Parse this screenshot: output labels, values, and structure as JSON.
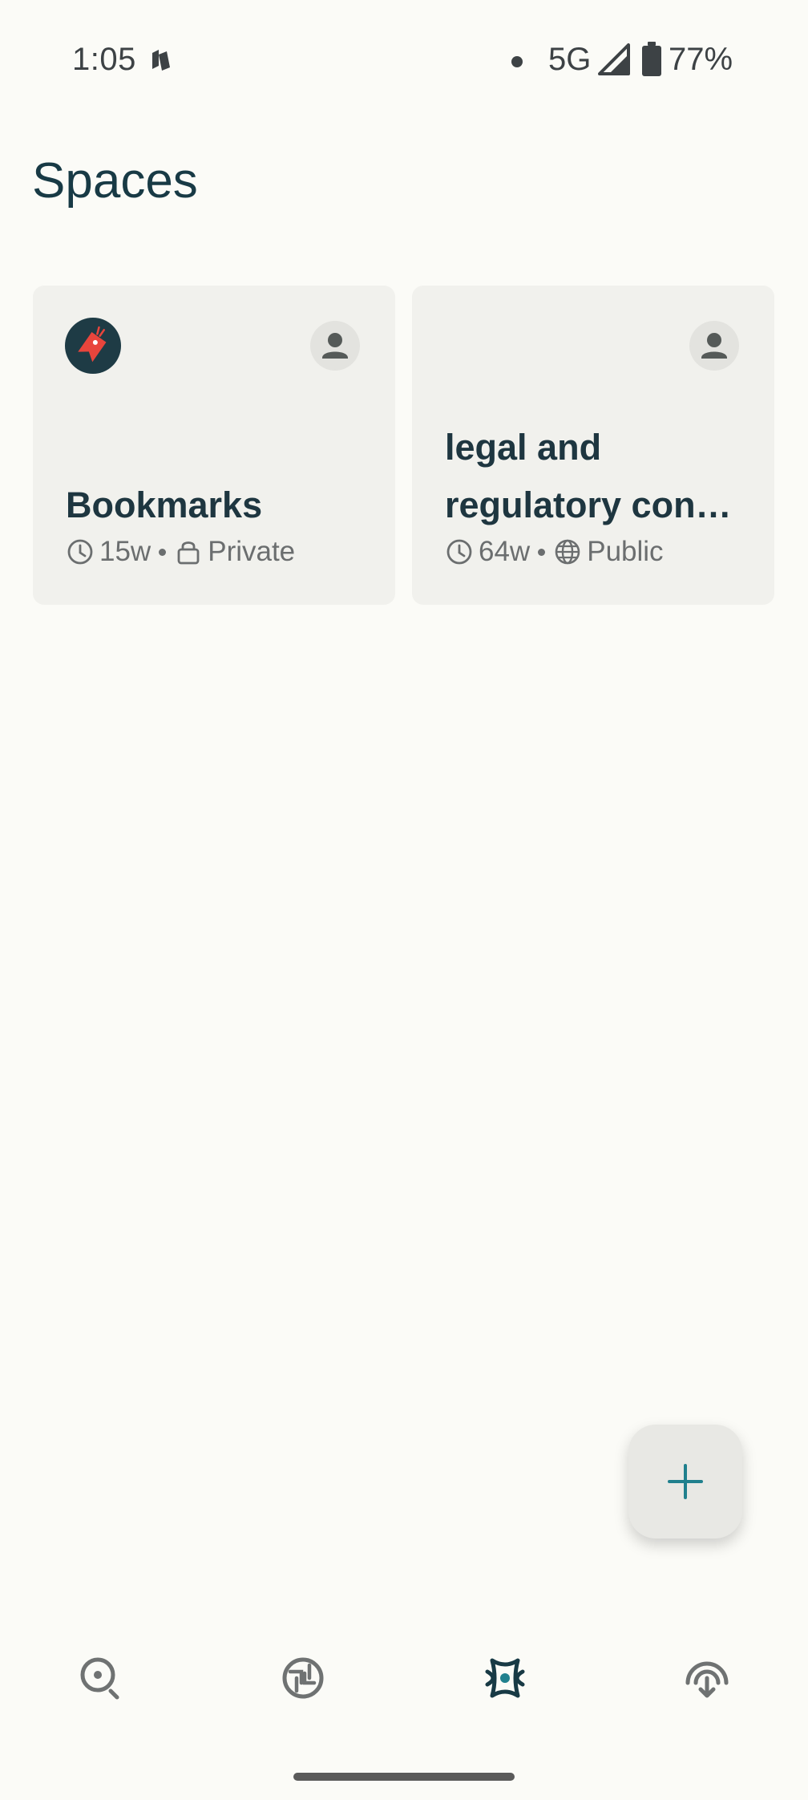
{
  "status_bar": {
    "time": "1:05",
    "network": "5G",
    "battery": "77%"
  },
  "page": {
    "title": "Spaces"
  },
  "spaces": [
    {
      "title": "Bookmarks",
      "age": "15w",
      "visibility": "Private",
      "visibility_icon": "lock-icon"
    },
    {
      "title": "legal and regulatory con…",
      "age": "64w",
      "visibility": "Public",
      "visibility_icon": "globe-icon"
    }
  ],
  "bottom_nav": {
    "items": [
      {
        "icon": "search-icon"
      },
      {
        "icon": "discover-icon"
      },
      {
        "icon": "spaces-icon",
        "active": true
      },
      {
        "icon": "library-icon"
      }
    ]
  },
  "colors": {
    "background": "#fbfbf7",
    "card": "#f1f1ed",
    "accent": "#20808d",
    "title": "#183a45"
  }
}
